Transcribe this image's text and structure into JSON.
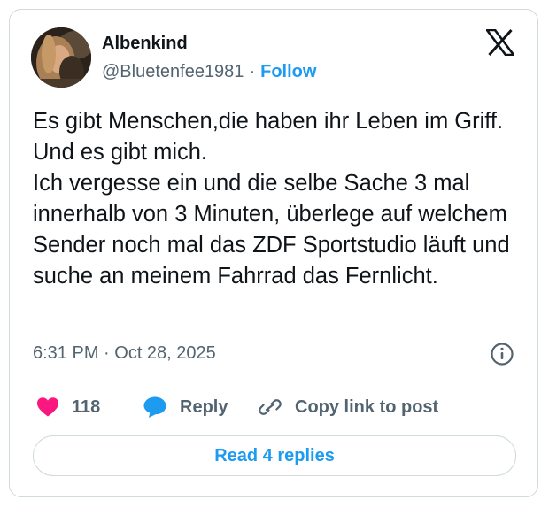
{
  "author": {
    "name": "Albenkind",
    "handle": "@Bluetenfee1981",
    "separator": "·",
    "follow_label": "Follow"
  },
  "tweet": {
    "text": "Es gibt Menschen,die haben ihr Leben im Griff. Und es gibt mich.\nIch vergesse ein und die selbe Sache 3 mal innerhalb von 3 Minuten, überlege auf welchem Sender noch mal das ZDF Sportstudio läuft und suche an meinem Fahrrad das Fernlicht.",
    "timestamp": "6:31 PM · Oct 28, 2025"
  },
  "actions": {
    "likes_count": "118",
    "reply_label": "Reply",
    "copy_link_label": "Copy link to post"
  },
  "read_replies_label": "Read 4 replies",
  "icons": {
    "logo": "x-logo-icon",
    "info": "info-icon",
    "like": "heart-icon",
    "reply": "speech-bubble-icon",
    "copy": "link-icon"
  },
  "colors": {
    "accent": "#1d9bf0",
    "like": "#f91880",
    "secondary_text": "#536471",
    "border": "#cfd9de"
  }
}
